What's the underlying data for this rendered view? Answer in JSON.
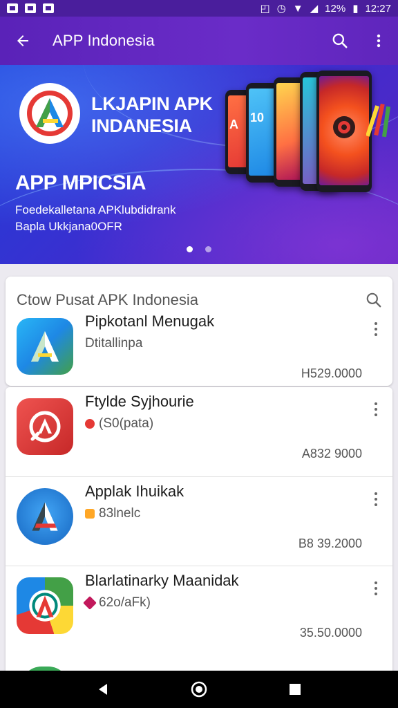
{
  "status_bar": {
    "battery": "12%",
    "time": "12:27"
  },
  "app_bar": {
    "title": "APP Indonesia"
  },
  "banner": {
    "title_line1": "LKJAPIN APK",
    "title_line2": "INDANESIA",
    "subtitle": "APP MPICSIA",
    "line1": "Foedekalletana APKlubdidrank",
    "line2": "Bapla Ukkjana0OFR",
    "phone_text_1": "A",
    "phone_text_2": "10",
    "page_count": 2,
    "active_page": 1
  },
  "section": {
    "label": "Ctow Pusat APK Indonesia"
  },
  "apps": [
    {
      "name": "Pipkotanl Menugak",
      "meta": "Dtitallinpa",
      "value": "H529.0000"
    },
    {
      "name": "Ftylde Syjhourie",
      "meta": "(S0(pata)",
      "value": "A832 9000"
    },
    {
      "name": "Applak Ihuikak",
      "meta": "83lnelc",
      "value": "B8 39.2000"
    },
    {
      "name": "Blarlatinarky Maanidak",
      "meta": "62o/aFk)",
      "value": "35.50.0000"
    }
  ],
  "colors": {
    "app_bar": "#5f25bc",
    "status_bar": "#4a1e9c",
    "accent_red": "#e53935"
  }
}
